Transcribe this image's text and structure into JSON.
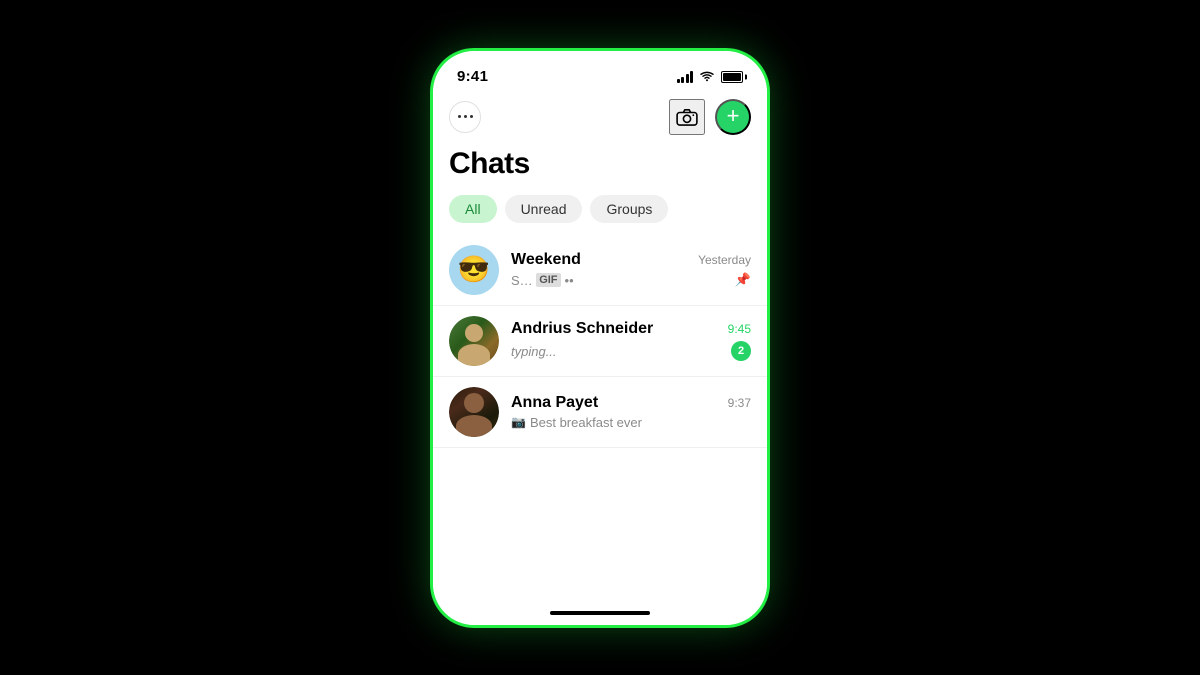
{
  "status_bar": {
    "time": "9:41",
    "battery_full": true
  },
  "header": {
    "dots_label": "···",
    "camera_label": "camera",
    "add_label": "+"
  },
  "title": "Chats",
  "filters": {
    "items": [
      {
        "label": "All",
        "active": true
      },
      {
        "label": "Unread",
        "active": false
      },
      {
        "label": "Groups",
        "active": false
      }
    ]
  },
  "chats": [
    {
      "id": "weekend",
      "name": "Weekend",
      "preview_sender": "Sofia:",
      "preview_text": "GIF ••",
      "time": "Yesterday",
      "pinned": true,
      "unread": 0,
      "emoji": "😎"
    },
    {
      "id": "andrius",
      "name": "Andrius Schneider",
      "preview_text": "typing...",
      "time": "9:45",
      "time_green": true,
      "pinned": false,
      "unread": 2
    },
    {
      "id": "anna",
      "name": "Anna Payet",
      "preview_text": "Best breakfast ever",
      "time": "9:37",
      "pinned": false,
      "unread": 0,
      "has_camera": true
    }
  ],
  "icons": {
    "pin": "📌",
    "camera": "📷"
  }
}
